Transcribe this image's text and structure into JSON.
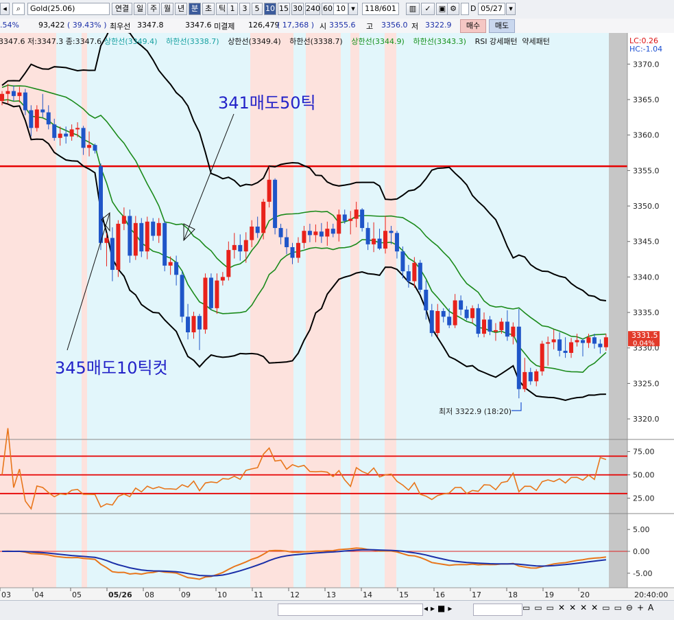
{
  "toolbar": {
    "symbol": "Gold(25.06)",
    "period_buttons": [
      "연결",
      "일",
      "주",
      "월",
      "년",
      "분",
      "초",
      "틱"
    ],
    "interval_buttons": [
      "1",
      "3",
      "5",
      "10",
      "15",
      "30",
      "240",
      "60"
    ],
    "interval_value": "10",
    "count": "118/601",
    "d_label": "D",
    "date": "05/27"
  },
  "info": {
    "change_pct": ".54%",
    "volume": "93,422",
    "volume_pct": "( 39.43% )",
    "best_label": "최우선",
    "best_bid": "3347.8",
    "best_ask": "3347.6",
    "open_interest_label": "미결제",
    "open_interest": "126,479",
    "oi_change": "( 17,368 )",
    "open_label": "시",
    "open": "3355.6",
    "high_label": "고",
    "high": "3356.0",
    "low_label": "저",
    "low": "3322.9",
    "buy_label": "매수",
    "sell_label": "매도"
  },
  "legend": {
    "ohlc": "3347.6 저:3347.3 종:3347.6",
    "items": [
      {
        "text": "상한선(3349.4)",
        "color": "#16a0a0"
      },
      {
        "text": "하한선(3338.7)",
        "color": "#16a0a0"
      },
      {
        "text": "상한선(3349.4)",
        "color": "#111111"
      },
      {
        "text": "하한선(3338.7)",
        "color": "#111111"
      },
      {
        "text": "상한선(3344.9)",
        "color": "#14901a"
      },
      {
        "text": "하한선(3343.3)",
        "color": "#14901a"
      },
      {
        "text": "RSI 강세패턴",
        "color": "#111111"
      },
      {
        "text": "약세패턴",
        "color": "#111111"
      }
    ],
    "lc": "LC:0.26",
    "hc": "HC:-1.04"
  },
  "annotations": {
    "sell50": "341매도50틱",
    "sell10": "345매도10틱컷",
    "low_note": "최저 3322.9 (18:20)"
  },
  "chart_data": {
    "type": "candlestick",
    "price_axis": {
      "ylim": [
        3317.3,
        3374.0
      ],
      "ticks": [
        "3370.0",
        "3365.0",
        "3360.0",
        "3355.0",
        "3350.0",
        "3345.0",
        "3340.0",
        "3335.0",
        "3330.0",
        "3325.0",
        "3320.0"
      ],
      "current_price": "3331.5",
      "current_change": "0.04%",
      "horizontal_line": 3355.6
    },
    "time_labels": [
      "03",
      "04",
      "05",
      "05/26",
      "08",
      "09",
      "10",
      "11",
      "12",
      "13",
      "14",
      "15",
      "16",
      "17",
      "18",
      "19",
      "20",
      "20:40:00"
    ],
    "candles_ohlc": [
      [
        3364.8,
        3366.2,
        3364.2,
        3365.8
      ],
      [
        3365.8,
        3367.2,
        3364.5,
        3366.2
      ],
      [
        3366.2,
        3367.0,
        3364.8,
        3365.5
      ],
      [
        3365.5,
        3366.8,
        3364.6,
        3366.0
      ],
      [
        3366.0,
        3366.5,
        3362.8,
        3363.5
      ],
      [
        3363.5,
        3364.2,
        3359.8,
        3361.0
      ],
      [
        3361.0,
        3364.2,
        3360.5,
        3363.6
      ],
      [
        3363.6,
        3365.8,
        3362.5,
        3363.2
      ],
      [
        3363.2,
        3364.2,
        3360.8,
        3361.5
      ],
      [
        3361.5,
        3362.3,
        3359.2,
        3359.6
      ],
      [
        3359.6,
        3361.2,
        3358.5,
        3360.2
      ],
      [
        3360.2,
        3361.2,
        3358.8,
        3359.8
      ],
      [
        3359.8,
        3361.5,
        3359.2,
        3360.8
      ],
      [
        3360.8,
        3361.8,
        3359.7,
        3361.0
      ],
      [
        3361.0,
        3361.3,
        3357.2,
        3358.2
      ],
      [
        3358.2,
        3360.5,
        3357.0,
        3358.6
      ],
      [
        3358.6,
        3358.8,
        3357.4,
        3357.8
      ],
      [
        3355.6,
        3356.0,
        3343.8,
        3344.8
      ],
      [
        3344.8,
        3346.2,
        3341.5,
        3345.5
      ],
      [
        3345.5,
        3347.0,
        3339.4,
        3341.0
      ],
      [
        3341.0,
        3348.0,
        3340.0,
        3347.5
      ],
      [
        3347.5,
        3349.8,
        3346.6,
        3348.6
      ],
      [
        3348.6,
        3349.5,
        3342.0,
        3343.0
      ],
      [
        3343.0,
        3348.6,
        3342.4,
        3347.6
      ],
      [
        3347.6,
        3348.3,
        3342.8,
        3343.6
      ],
      [
        3343.6,
        3348.5,
        3342.5,
        3347.8
      ],
      [
        3347.8,
        3348.3,
        3345.1,
        3345.8
      ],
      [
        3345.8,
        3348.3,
        3344.8,
        3347.6
      ],
      [
        3347.6,
        3347.9,
        3340.8,
        3341.6
      ],
      [
        3341.6,
        3342.9,
        3340.3,
        3342.1
      ],
      [
        3342.1,
        3343.0,
        3338.8,
        3340.3
      ],
      [
        3340.3,
        3340.8,
        3333.6,
        3334.4
      ],
      [
        3334.4,
        3336.2,
        3331.2,
        3332.2
      ],
      [
        3332.2,
        3335.1,
        3331.3,
        3334.5
      ],
      [
        3334.5,
        3334.8,
        3329.7,
        3332.6
      ],
      [
        3332.6,
        3340.5,
        3332.0,
        3339.9
      ],
      [
        3339.9,
        3340.5,
        3335.3,
        3335.6
      ],
      [
        3335.6,
        3340.5,
        3334.8,
        3339.5
      ],
      [
        3339.5,
        3340.7,
        3338.8,
        3340.0
      ],
      [
        3340.0,
        3345.0,
        3339.5,
        3343.8
      ],
      [
        3343.8,
        3346.2,
        3342.6,
        3344.5
      ],
      [
        3344.5,
        3346.0,
        3342.3,
        3343.6
      ],
      [
        3343.6,
        3346.3,
        3342.0,
        3345.2
      ],
      [
        3345.2,
        3348.0,
        3344.2,
        3347.1
      ],
      [
        3347.1,
        3348.5,
        3345.5,
        3346.2
      ],
      [
        3346.2,
        3351.0,
        3345.3,
        3350.6
      ],
      [
        3350.6,
        3355.6,
        3349.8,
        3353.7
      ],
      [
        3353.7,
        3353.9,
        3346.0,
        3346.9
      ],
      [
        3346.9,
        3347.5,
        3344.6,
        3345.6
      ],
      [
        3345.6,
        3346.8,
        3343.2,
        3344.2
      ],
      [
        3344.2,
        3344.8,
        3341.8,
        3342.7
      ],
      [
        3342.7,
        3345.6,
        3342.0,
        3344.8
      ],
      [
        3344.8,
        3347.2,
        3344.0,
        3346.5
      ],
      [
        3346.5,
        3347.5,
        3344.9,
        3345.9
      ],
      [
        3345.9,
        3347.4,
        3344.9,
        3346.4
      ],
      [
        3346.4,
        3347.6,
        3344.8,
        3345.7
      ],
      [
        3345.7,
        3347.8,
        3344.4,
        3346.8
      ],
      [
        3346.8,
        3347.5,
        3345.6,
        3346.1
      ],
      [
        3346.1,
        3349.5,
        3345.0,
        3348.8
      ],
      [
        3348.8,
        3349.5,
        3347.5,
        3347.9
      ],
      [
        3347.9,
        3349.3,
        3346.0,
        3348.2
      ],
      [
        3348.2,
        3350.6,
        3347.0,
        3349.5
      ],
      [
        3349.5,
        3349.7,
        3346.4,
        3346.9
      ],
      [
        3346.9,
        3347.7,
        3343.8,
        3344.6
      ],
      [
        3344.6,
        3347.7,
        3343.5,
        3345.4
      ],
      [
        3345.4,
        3346.8,
        3343.8,
        3344.0
      ],
      [
        3344.0,
        3348.6,
        3343.3,
        3346.5
      ],
      [
        3346.5,
        3347.2,
        3344.6,
        3346.2
      ],
      [
        3346.2,
        3346.5,
        3342.6,
        3343.6
      ],
      [
        3343.6,
        3344.3,
        3339.8,
        3340.8
      ],
      [
        3340.8,
        3341.7,
        3338.5,
        3339.4
      ],
      [
        3339.4,
        3342.8,
        3338.5,
        3342.0
      ],
      [
        3342.0,
        3342.4,
        3337.8,
        3338.2
      ],
      [
        3338.2,
        3339.5,
        3334.0,
        3335.3
      ],
      [
        3335.3,
        3336.2,
        3331.6,
        3332.1
      ],
      [
        3332.1,
        3336.2,
        3331.6,
        3335.2
      ],
      [
        3335.2,
        3335.6,
        3333.6,
        3334.4
      ],
      [
        3334.4,
        3335.6,
        3332.8,
        3333.2
      ],
      [
        3333.2,
        3337.6,
        3332.8,
        3336.7
      ],
      [
        3336.7,
        3337.4,
        3334.6,
        3335.4
      ],
      [
        3335.4,
        3335.9,
        3333.9,
        3334.2
      ],
      [
        3334.2,
        3336.0,
        3333.5,
        3335.6
      ],
      [
        3335.6,
        3336.2,
        3331.5,
        3332.0
      ],
      [
        3332.0,
        3335.0,
        3331.5,
        3334.0
      ],
      [
        3334.0,
        3334.5,
        3331.8,
        3332.3
      ],
      [
        3332.3,
        3333.5,
        3331.0,
        3332.5
      ],
      [
        3332.5,
        3334.2,
        3332.0,
        3333.7
      ],
      [
        3333.7,
        3335.3,
        3331.0,
        3331.6
      ],
      [
        3331.6,
        3333.6,
        3330.5,
        3333.0
      ],
      [
        3333.0,
        3335.5,
        3322.9,
        3324.2
      ],
      [
        3324.2,
        3328.6,
        3323.8,
        3326.6
      ],
      [
        3326.6,
        3327.2,
        3324.8,
        3325.3
      ],
      [
        3325.3,
        3327.0,
        3324.6,
        3326.7
      ],
      [
        3326.7,
        3331.0,
        3326.1,
        3330.6
      ],
      [
        3330.6,
        3331.6,
        3327.5,
        3330.8
      ],
      [
        3330.8,
        3332.6,
        3329.8,
        3331.2
      ],
      [
        3331.2,
        3332.2,
        3328.8,
        3329.6
      ],
      [
        3329.6,
        3331.5,
        3328.6,
        3329.3
      ],
      [
        3329.3,
        3331.4,
        3328.6,
        3330.8
      ],
      [
        3330.8,
        3332.0,
        3330.2,
        3331.1
      ],
      [
        3331.1,
        3331.3,
        3328.8,
        3330.7
      ],
      [
        3330.7,
        3332.0,
        3330.0,
        3331.5
      ],
      [
        3331.5,
        3332.0,
        3329.9,
        3330.6
      ],
      [
        3330.6,
        3331.2,
        3329.2,
        3330.1
      ],
      [
        3330.1,
        3332.0,
        3329.6,
        3331.5
      ]
    ],
    "rsi_axis": {
      "ticks": [
        "75.00",
        "50.00",
        "25.00"
      ],
      "lines": [
        70,
        50,
        30
      ]
    },
    "macd_axis": {
      "ticks": [
        "5.00",
        "0.00",
        "-5.00"
      ]
    }
  }
}
